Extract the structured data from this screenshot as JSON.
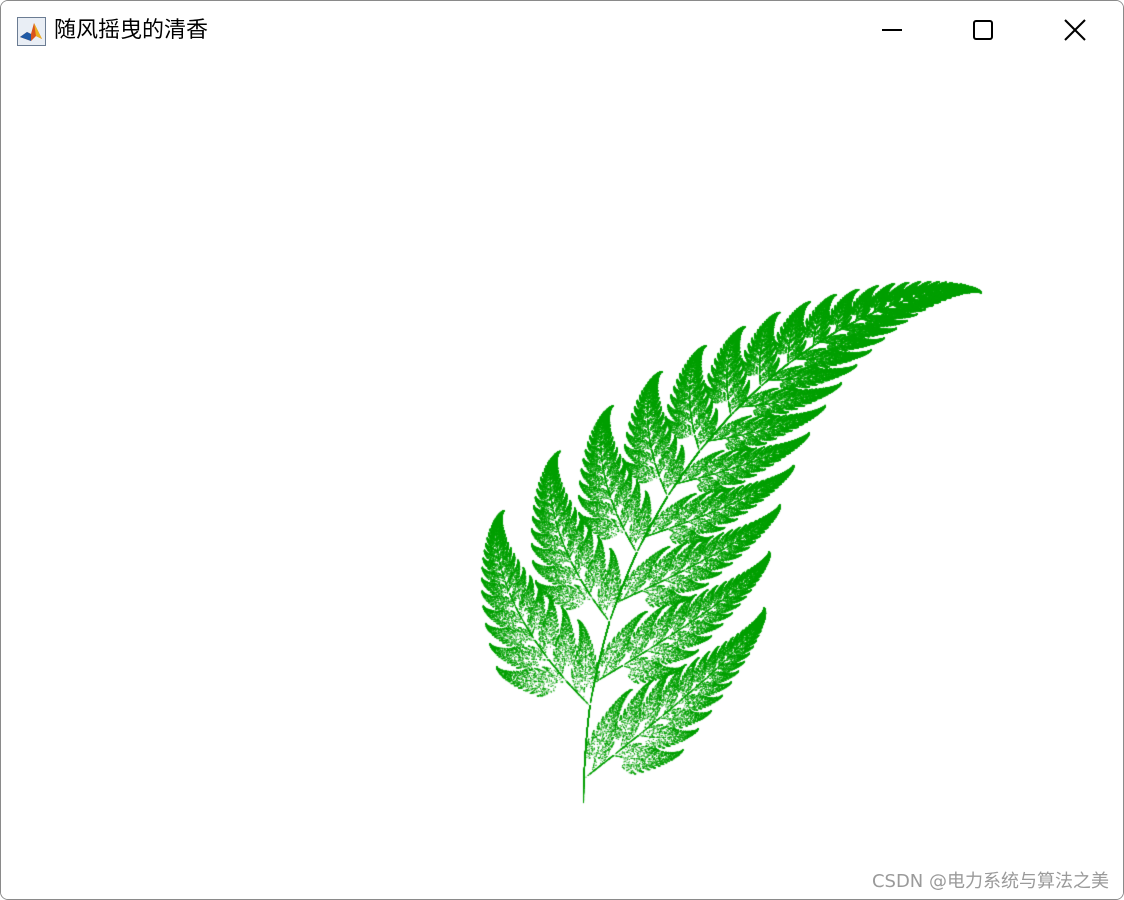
{
  "window": {
    "title": "随风摇曳的清香",
    "icon": "matlab-icon"
  },
  "controls": {
    "minimize_icon": "minimize-icon",
    "maximize_icon": "maximize-icon",
    "close_icon": "close-icon"
  },
  "figure": {
    "type": "barnsley-fern-scatter",
    "color": "#00a000",
    "background": "#ffffff",
    "axes_visible": false
  },
  "watermark": "CSDN @电力系统与算法之美"
}
